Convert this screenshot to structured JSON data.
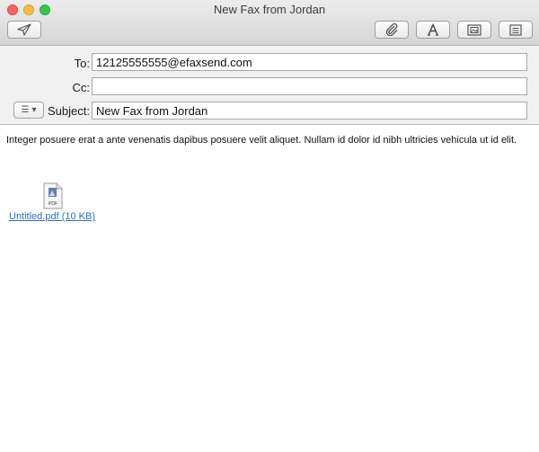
{
  "window": {
    "title": "New Fax from Jordan"
  },
  "toolbar": {
    "send_icon": "paper-plane-icon",
    "attach_icon": "paperclip-icon",
    "format_icon": "font-A-icon",
    "photo_icon": "photo-browser-icon",
    "stationery_icon": "template-icon"
  },
  "headers": {
    "to_label": "To:",
    "to_value": "12125555555@efaxsend.com",
    "cc_label": "Cc:",
    "cc_value": "",
    "subject_label": "Subject:",
    "subject_value": "New Fax from Jordan",
    "menu_glyph": "☰",
    "menu_arrow": "▾"
  },
  "body": {
    "text": "Integer posuere erat a ante venenatis dapibus posuere velit aliquet. Nullam id dolor id nibh ultricies vehicula ut id elit."
  },
  "attachment": {
    "icon_label": "PDF",
    "link_text": "Untitled.pdf (10 KB)"
  },
  "colors": {
    "link": "#2a6fc9",
    "close": "#fc605c",
    "minimize": "#fdbc40",
    "zoom": "#34c84a"
  }
}
